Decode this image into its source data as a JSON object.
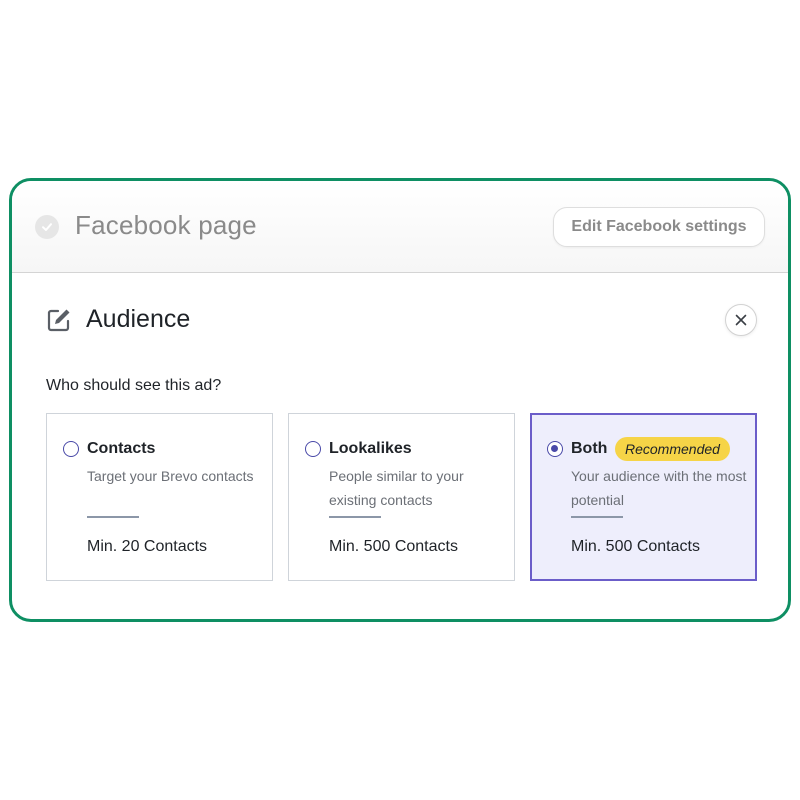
{
  "facebook_step": {
    "title": "Facebook page",
    "edit_button_label": "Edit Facebook settings"
  },
  "audience": {
    "title": "Audience",
    "question": "Who should see this ad?",
    "options": [
      {
        "title": "Contacts",
        "description": "Target your Brevo contacts",
        "minimum": "Min. 20 Contacts",
        "selected": false
      },
      {
        "title": "Lookalikes",
        "description": "People similar to your existing contacts",
        "minimum": "Min. 500 Contacts",
        "selected": false
      },
      {
        "title": "Both",
        "badge": "Recommended",
        "description": "Your audience with the most potential",
        "minimum": "Min. 500 Contacts",
        "selected": true
      }
    ]
  },
  "colors": {
    "frame_border": "#0e8f63",
    "selected_border": "#6b5dc9",
    "selected_background": "#eeeefc",
    "badge_background": "#f6d447",
    "radio": "#4a4aa8"
  },
  "icons": [
    "check-circle-icon",
    "edit-icon",
    "close-icon",
    "radio-icon"
  ]
}
